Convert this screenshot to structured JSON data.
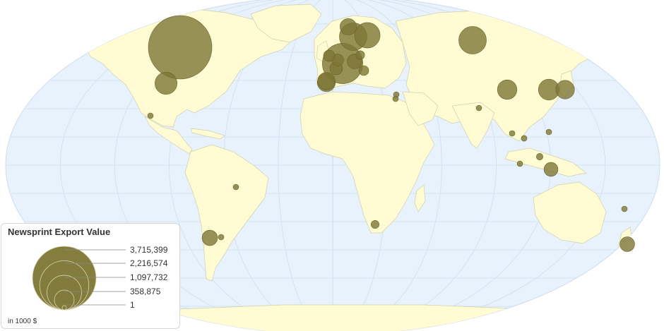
{
  "map": {
    "title": "Newsprint Export Value",
    "unit_note": "in 1000 $",
    "colors": {
      "ocean": "#e8f2fc",
      "land": "#fffcd4",
      "border": "#cfcfb0",
      "graticule": "#cfe0f0",
      "bubble": "#7e7634",
      "bubble_stroke": "#6a6328"
    },
    "legend": {
      "values": [
        3715399,
        2216574,
        1097732,
        358875,
        1
      ],
      "labels": [
        "3,715,399",
        "2,216,574",
        "1,097,732",
        "358,875",
        "1"
      ]
    },
    "bubbles": [
      {
        "country": "Canada",
        "value": 3715399
      },
      {
        "country": "United States",
        "value": 450000
      },
      {
        "country": "Sweden",
        "value": 700000
      },
      {
        "country": "Finland",
        "value": 600000
      },
      {
        "country": "Russia",
        "value": 700000
      },
      {
        "country": "Germany",
        "value": 1500000
      },
      {
        "country": "France",
        "value": 300000
      },
      {
        "country": "United Kingdom",
        "value": 120000
      },
      {
        "country": "Norway",
        "value": 250000
      },
      {
        "country": "Austria",
        "value": 200000
      },
      {
        "country": "Belgium",
        "value": 150000
      },
      {
        "country": "Netherlands",
        "value": 130000
      },
      {
        "country": "Spain",
        "value": 280000
      },
      {
        "country": "Italy",
        "value": 90000
      },
      {
        "country": "Poland",
        "value": 70000
      },
      {
        "country": "China",
        "value": 350000
      },
      {
        "country": "Japan",
        "value": 320000
      },
      {
        "country": "South Korea",
        "value": 400000
      },
      {
        "country": "Taiwan",
        "value": 20000
      },
      {
        "country": "Indonesia",
        "value": 180000
      },
      {
        "country": "Philippines",
        "value": 40000
      },
      {
        "country": "Malaysia",
        "value": 30000
      },
      {
        "country": "Thailand",
        "value": 12000
      },
      {
        "country": "Vietnam",
        "value": 10000
      },
      {
        "country": "India",
        "value": 8000
      },
      {
        "country": "Australia",
        "value": 1000
      },
      {
        "country": "New Zealand",
        "value": 200000
      },
      {
        "country": "Chile",
        "value": 220000
      },
      {
        "country": "Brazil",
        "value": 10000
      },
      {
        "country": "Argentina",
        "value": 8000
      },
      {
        "country": "Mexico",
        "value": 8000
      },
      {
        "country": "South Africa",
        "value": 60000
      },
      {
        "country": "Turkey",
        "value": 10000
      },
      {
        "country": "Egypt",
        "value": 8000
      }
    ]
  }
}
